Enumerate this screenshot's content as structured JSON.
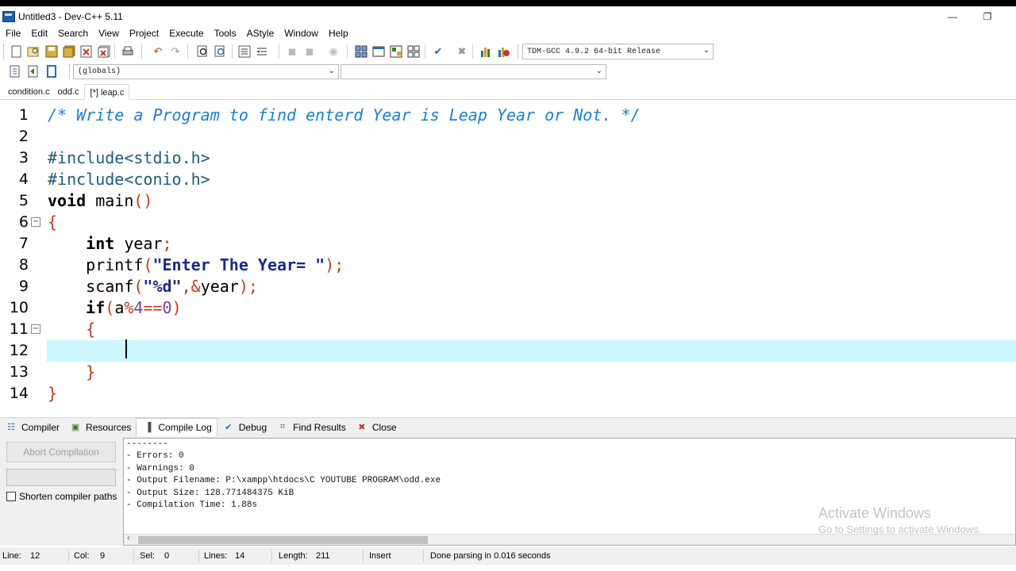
{
  "window": {
    "title": "Untitled3 - Dev-C++ 5.11",
    "controls": {
      "minimize": "—",
      "restore": "❐"
    }
  },
  "menu": [
    "File",
    "Edit",
    "Search",
    "View",
    "Project",
    "Execute",
    "Tools",
    "AStyle",
    "Window",
    "Help"
  ],
  "toolbar": {
    "compiler_select": "TDM-GCC 4.9.2 64-bit Release",
    "scope_select": "(globals)",
    "symbol_select": ""
  },
  "file_tabs": [
    "condition.c",
    "odd.c",
    "[*] leap.c"
  ],
  "active_tab_index": 2,
  "editor": {
    "lines": [
      {
        "n": "1",
        "parts": [
          [
            "comment",
            "/* Write a Program to find enterd Year is Leap Year or Not. */"
          ]
        ]
      },
      {
        "n": "2",
        "parts": []
      },
      {
        "n": "3",
        "parts": [
          [
            "preproc",
            "#include<stdio.h>"
          ]
        ]
      },
      {
        "n": "4",
        "parts": [
          [
            "preproc",
            "#include<conio.h>"
          ]
        ]
      },
      {
        "n": "5",
        "parts": [
          [
            "kw",
            "void"
          ],
          [
            "plain",
            " main"
          ],
          [
            "sym",
            "()"
          ]
        ]
      },
      {
        "n": "6",
        "parts": [
          [
            "sym",
            "{"
          ]
        ],
        "fold": "−"
      },
      {
        "n": "7",
        "parts": [
          [
            "plain",
            "    "
          ],
          [
            "kw",
            "int"
          ],
          [
            "plain",
            " year"
          ],
          [
            "sym",
            ";"
          ]
        ]
      },
      {
        "n": "8",
        "parts": [
          [
            "plain",
            "    printf"
          ],
          [
            "sym",
            "("
          ],
          [
            "str",
            "\"Enter The Year= \""
          ],
          [
            "sym",
            ");"
          ]
        ]
      },
      {
        "n": "9",
        "parts": [
          [
            "plain",
            "    scanf"
          ],
          [
            "sym",
            "("
          ],
          [
            "str",
            "\"%d\""
          ],
          [
            "sym",
            ",&"
          ],
          [
            "plain",
            "year"
          ],
          [
            "sym",
            ");"
          ]
        ]
      },
      {
        "n": "10",
        "parts": [
          [
            "plain",
            "    "
          ],
          [
            "kw",
            "if"
          ],
          [
            "sym",
            "("
          ],
          [
            "plain",
            "a"
          ],
          [
            "sym",
            "%"
          ],
          [
            "num",
            "4"
          ],
          [
            "sym",
            "=="
          ],
          [
            "num",
            "0"
          ],
          [
            "sym",
            ")"
          ]
        ]
      },
      {
        "n": "11",
        "parts": [
          [
            "plain",
            "    "
          ],
          [
            "sym",
            "{"
          ]
        ],
        "fold": "−"
      },
      {
        "n": "12",
        "parts": [],
        "current": true
      },
      {
        "n": "13",
        "parts": [
          [
            "plain",
            "    "
          ],
          [
            "sym",
            "}"
          ]
        ]
      },
      {
        "n": "14",
        "parts": [
          [
            "sym",
            "}"
          ]
        ]
      }
    ]
  },
  "panel_tabs": [
    {
      "label": "Compiler",
      "icon": "compiler-icon",
      "glyph": "☷",
      "color": "#2d6db3"
    },
    {
      "label": "Resources",
      "icon": "resources-icon",
      "glyph": "▣",
      "color": "#3b7a2a"
    },
    {
      "label": "Compile Log",
      "icon": "compile-log-icon",
      "glyph": "▐",
      "color": "#4a4a4a",
      "active": true
    },
    {
      "label": "Debug",
      "icon": "debug-icon",
      "glyph": "✔",
      "color": "#2a6cb0"
    },
    {
      "label": "Find Results",
      "icon": "find-results-icon",
      "glyph": "⌗",
      "color": "#555555"
    },
    {
      "label": "Close",
      "icon": "close-panel-icon",
      "glyph": "✖",
      "color": "#c0392b"
    }
  ],
  "compile_panel": {
    "abort_label": "Abort Compilation",
    "shorten_label": "Shorten compiler paths",
    "log": [
      "--------",
      "- Errors: 0",
      "- Warnings: 0",
      "- Output Filename: P:\\xampp\\htdocs\\C YOUTUBE PROGRAM\\odd.exe",
      "- Output Size: 128.771484375 KiB",
      "- Compilation Time: 1.88s"
    ]
  },
  "watermark": {
    "line1": "Activate Windows",
    "line2": "Go to Settings to activate Windows."
  },
  "status": {
    "line_label": "Line:",
    "line_value": "12",
    "col_label": "Col:",
    "col_value": "9",
    "sel_label": "Sel:",
    "sel_value": "0",
    "lines_label": "Lines:",
    "lines_value": "14",
    "length_label": "Length:",
    "length_value": "211",
    "mode": "Insert",
    "message": "Done parsing in 0.016 seconds"
  },
  "colors": {
    "current_line": "#ccf7ff",
    "comment": "#1a7fd4",
    "symbol": "#c43a1e",
    "string": "#1a2a8a"
  }
}
